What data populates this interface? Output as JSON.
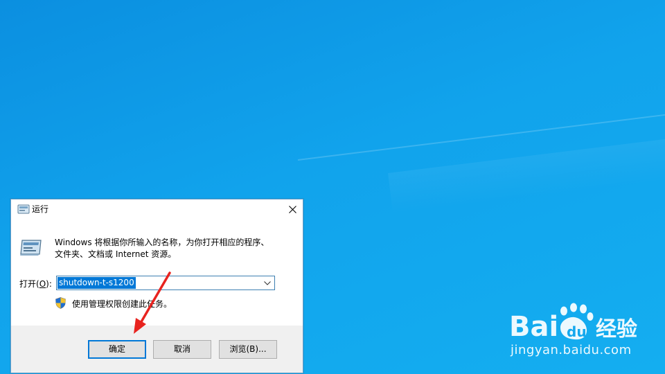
{
  "dialog": {
    "title": "运行",
    "description_line1": "Windows 将根据你所输入的名称，为你打开相应的程序、",
    "description_line2": "文件夹、文档或 Internet 资源。",
    "open_label_prefix": "打开(",
    "open_label_key": "O",
    "open_label_suffix": "):",
    "command_value": "shutdown-t-s1200",
    "admin_note": "使用管理权限创建此任务。",
    "buttons": {
      "ok": "确定",
      "cancel": "取消",
      "browse": "浏览(B)..."
    }
  },
  "icons": {
    "title": "run-program-icon",
    "main": "run-program-icon",
    "close": "close-icon",
    "dropdown": "chevron-down-icon",
    "shield": "uac-shield-icon"
  },
  "watermark": {
    "logo_text": "Baidu经验",
    "url": "jingyan.baidu.com"
  },
  "colors": {
    "desktop": "#0b8fe0",
    "selection": "#0078d7",
    "annotation_arrow": "#e8231f"
  }
}
